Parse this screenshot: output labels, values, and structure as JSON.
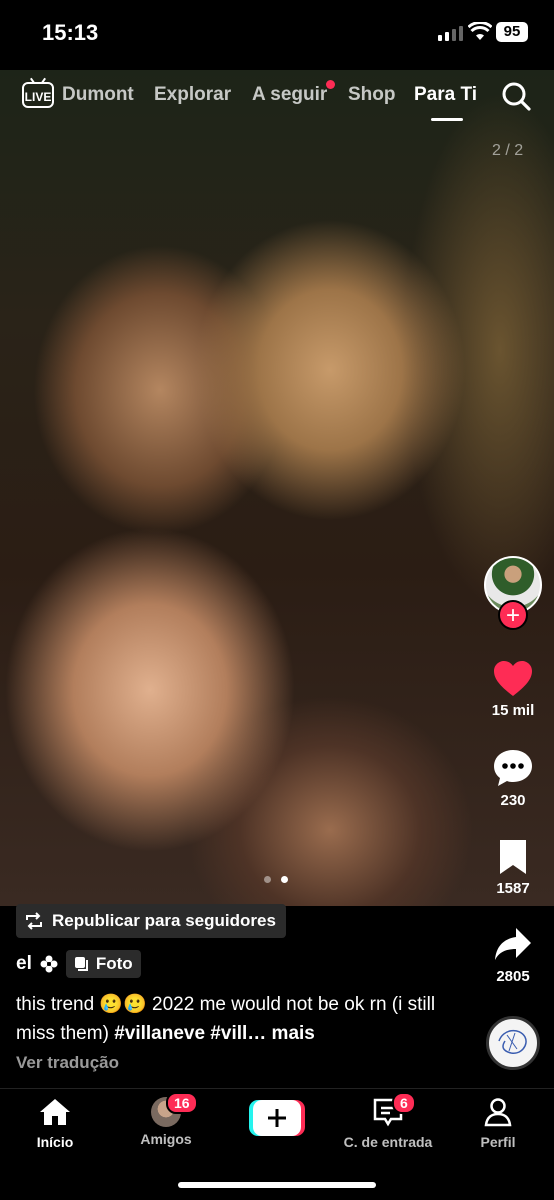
{
  "status_bar": {
    "time": "15:13",
    "battery": "95"
  },
  "top_nav": {
    "live_label": "LIVE",
    "tabs": [
      "Dumont",
      "Explorar",
      "A seguir",
      "Shop",
      "Para Ti"
    ],
    "active_tab": "Para Ti"
  },
  "photo": {
    "counter": "2 / 2",
    "page_total": 2,
    "page_current": 2
  },
  "actions": {
    "likes": "15 mil",
    "comments": "230",
    "saves": "1587",
    "shares": "2805"
  },
  "post": {
    "repost_label": "Republicar para seguidores",
    "username": "el",
    "type_label": "Foto",
    "caption_text": "this trend 🥲🥲 2022 me would not be ok rn (i still miss them) ",
    "hashtags": "#villaneve #vill…",
    "more_label": " mais",
    "translate_label": "Ver tradução"
  },
  "bottom_nav": {
    "home": "Início",
    "friends": "Amigos",
    "friends_badge": "16",
    "inbox": "C. de entrada",
    "inbox_badge": "6",
    "profile": "Perfil"
  },
  "colors": {
    "accent": "#fe2c55",
    "background": "#000000"
  }
}
